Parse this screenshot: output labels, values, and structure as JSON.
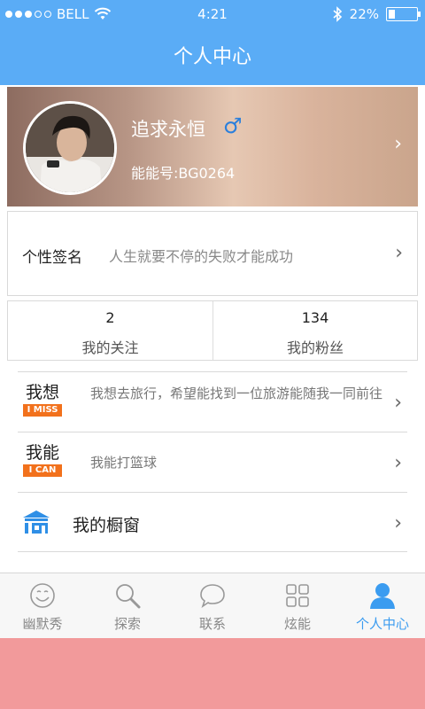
{
  "status_bar": {
    "carrier": "BELL",
    "time": "4:21",
    "battery_percent": "22%",
    "battery_level": 0.22,
    "signal_dots_filled": 3,
    "signal_dots_total": 5
  },
  "header": {
    "title": "个人中心"
  },
  "profile": {
    "name": "追求永恒",
    "gender_symbol": "♂",
    "id_text": "能能号:BG0264"
  },
  "signature": {
    "label": "个性签名",
    "text": "人生就要不停的失败才能成功"
  },
  "stats": [
    {
      "count": "2",
      "label": "我的关注"
    },
    {
      "count": "134",
      "label": "我的粉丝"
    }
  ],
  "items": [
    {
      "title": "我想",
      "badge": "I MISS",
      "text": "我想去旅行，希望能找到一位旅游能随我一同前往"
    },
    {
      "title": "我能",
      "badge": "I CAN",
      "text": "我能打篮球"
    }
  ],
  "showcase": {
    "label": "我的橱窗",
    "icon": "shop-icon"
  },
  "tabs": [
    {
      "label": "幽默秀",
      "icon": "smiley-icon"
    },
    {
      "label": "探索",
      "icon": "search-icon"
    },
    {
      "label": "联系",
      "icon": "chat-bubble-icon"
    },
    {
      "label": "炫能",
      "icon": "grid-icon"
    },
    {
      "label": "个人中心",
      "icon": "person-icon",
      "active": true
    }
  ],
  "colors": {
    "accent": "#5aacf6",
    "active_tab": "#3b9cf0",
    "badge": "#f2711c",
    "gender": "#2a7fdc"
  }
}
